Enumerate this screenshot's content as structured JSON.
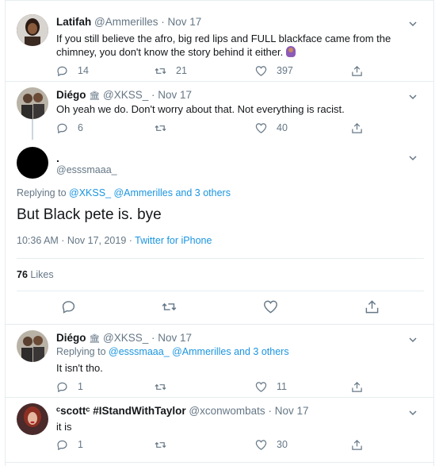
{
  "replies_top": [
    {
      "name": "Latifah",
      "handle": "@Ammerilles",
      "date": "Nov 17",
      "text": "If you still believe the afro, big red lips and FULL blackface came from the chimney, you don't know the story behind it either.",
      "replies": "14",
      "retweets": "21",
      "likes": "397"
    },
    {
      "name": "Diégo",
      "badge": "🏛",
      "handle": "@XKSS_",
      "date": "Nov 17",
      "text": "Oh yeah we do. Don't worry about that. Not everything is racist.",
      "replies": "6",
      "retweets": "",
      "likes": "40"
    }
  ],
  "main": {
    "name": ".",
    "handle": "@esssmaaa_",
    "replying_prefix": "Replying to",
    "replying_users": "@XKSS_ @Ammerilles and 3 others",
    "text": "But Black pete is. bye",
    "time": "10:36 AM · Nov 17, 2019",
    "sep": " · ",
    "source": "Twitter for iPhone",
    "likes_count": "76",
    "likes_label": "Likes"
  },
  "replies_bottom": [
    {
      "name": "Diégo",
      "badge": "🏛",
      "handle": "@XKSS_",
      "date": "Nov 17",
      "replying_prefix": "Replying to",
      "replying_users": "@esssmaaa_ @Ammerilles and 3 others",
      "text": "It isn't tho.",
      "replies": "1",
      "retweets": "",
      "likes": "11"
    },
    {
      "name": "ᶜscottᶜ #IStandWithTaylor",
      "handle": "@xconwombats",
      "date": "Nov 17",
      "text": "it is",
      "replies": "1",
      "retweets": "",
      "likes": "30"
    }
  ],
  "dot": "·",
  "colors": {
    "link": "#1b95e0",
    "muted": "#657786",
    "border": "#e6ecf0"
  }
}
